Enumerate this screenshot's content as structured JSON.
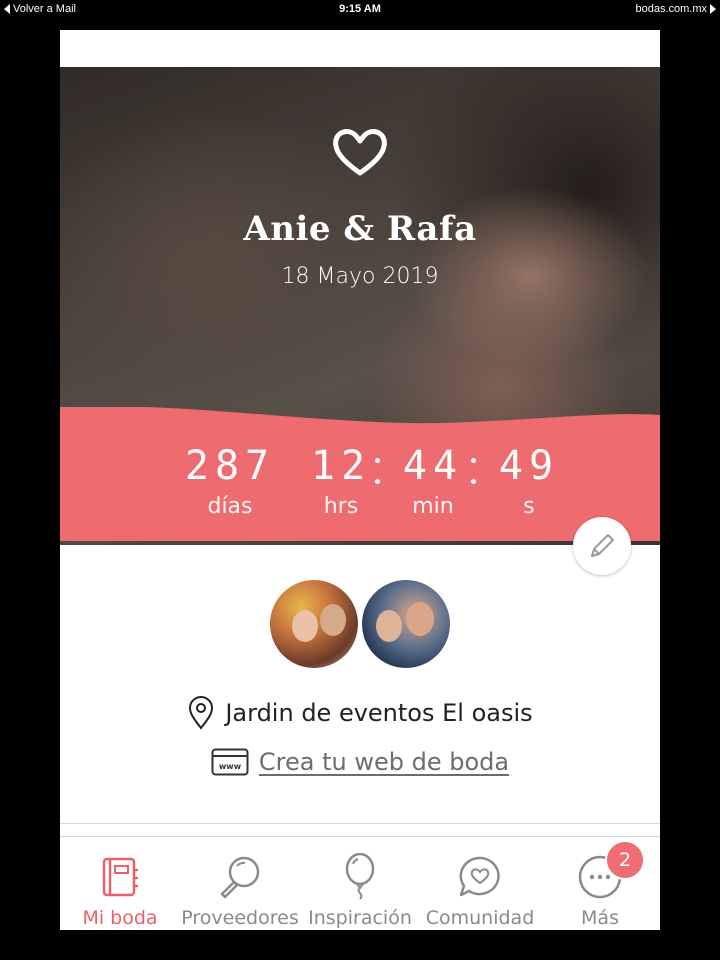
{
  "status_bar": {
    "back_label": "Volver a Mail",
    "time": "9:15 AM",
    "url": "bodas.com.mx"
  },
  "hero": {
    "couple_name": "Anie & Rafa",
    "date": "18 Mayo 2019",
    "countdown": [
      {
        "value": "287",
        "label": "días"
      },
      {
        "value": "12",
        "label": "hrs"
      },
      {
        "value": "44",
        "label": "min"
      },
      {
        "value": "49",
        "label": "s"
      }
    ]
  },
  "details": {
    "venue": "Jardin de eventos El oasis",
    "web_link": "Crea tu web de boda"
  },
  "tabbar": {
    "items": [
      {
        "label": "Mi boda",
        "icon": "notebook-icon",
        "active": true
      },
      {
        "label": "Proveedores",
        "icon": "magnifier-icon"
      },
      {
        "label": "Inspiración",
        "icon": "balloon-icon"
      },
      {
        "label": "Comunidad",
        "icon": "chat-heart-icon"
      },
      {
        "label": "Más",
        "icon": "more-dots-icon",
        "badge": "2"
      }
    ]
  },
  "colors": {
    "accent": "#ee6b70",
    "active_tab": "#e9616b"
  }
}
